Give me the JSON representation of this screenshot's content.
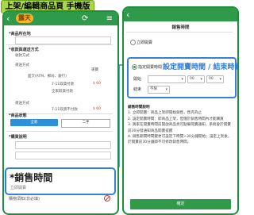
{
  "banner": {
    "title": "上架/編輯商品頁 手機版"
  },
  "left_phone": {
    "topbar": {
      "logo": "露天"
    },
    "sections": {
      "location": "*商品所在地",
      "pay_ship": "*收款與運送方式",
      "pay_label": "收款方式",
      "ship_label": "運送方式",
      "ship_label2": "運費",
      "condition": "*商品狀態",
      "stock": "*購買說明",
      "all_btn": "全新",
      "used_btn": "二手"
    },
    "rows": [
      {
        "left": "面交(ATM、郵局、銀行) ",
        "right": ""
      },
      {
        "left": "",
        "right": "7-11取貨付款"
      },
      {
        "left": "",
        "right": "全家取貨付款"
      },
      {
        "left": "",
        "right": "7-11取貨不付款"
      }
    ],
    "prices": [
      "$ 60",
      "$ 60"
    ],
    "sales": {
      "title": "*銷售時間",
      "sub": "立即開賣"
    },
    "rules": "購物須知(非必填)"
  },
  "right_phone": {
    "title": "銷售時間",
    "opt1": "立即開賣",
    "opt2": "指定開賣時間",
    "overlay": "設定開賣時間 / 結束時間",
    "start_label": "開始",
    "start_hour": "00",
    "start_min": "00",
    "end_label": "結束",
    "end_value": "不限",
    "notes_title": "銷售時間說明",
    "notes": [
      "1. 立即開賣：商品上架即開始銷售，售完為止",
      "2. 設定開賣時間：即商品上架，但僅於銷售時間內才能購買",
      "3. 買家在開賣時間前開啟商品頁可點擊開賣通知，系統會於開賣前30分發通知商品開賣提醒",
      "4. 銷售期間時間變更可設定下時間+30分鐘開始；設定上架後，於開賣前30分鐘即不可修改銷售時間。"
    ],
    "confirm": "確定"
  },
  "colors": {
    "green": "#2e9a4a",
    "blue": "#3a7fd6",
    "banner": "#a8d84a"
  }
}
